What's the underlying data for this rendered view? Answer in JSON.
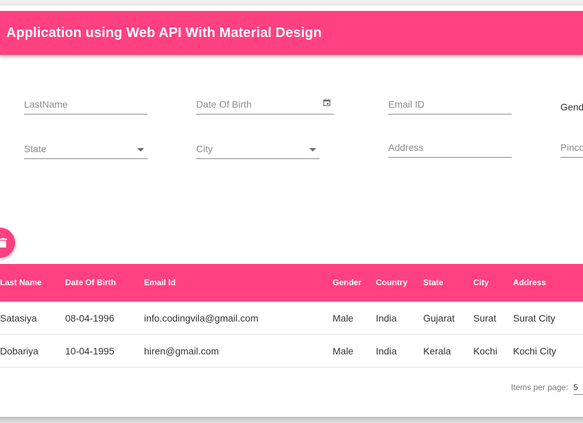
{
  "header": {
    "title": "Application using Web API With Material Design"
  },
  "form": {
    "row1": {
      "lastname_placeholder": "LastName",
      "dob_placeholder": "Date Of Birth",
      "email_placeholder": "Email ID",
      "gender_label": "Gend"
    },
    "row2": {
      "state_placeholder": "State",
      "city_placeholder": "City",
      "address_placeholder": "Address",
      "pincode_placeholder": "Pinco"
    }
  },
  "fab": {
    "icon": "delete-icon"
  },
  "table": {
    "columns": [
      "Last Name",
      "Date Of Birth",
      "Email Id",
      "Gender",
      "Country",
      "State",
      "City",
      "Address"
    ],
    "rows": [
      [
        "Satasiya",
        "08-04-1996",
        "info.codingvila@gmail.com",
        "Male",
        "India",
        "Gujarat",
        "Surat",
        "Surat City"
      ],
      [
        "Dobariya",
        "10-04-1995",
        "hiren@gmail.com",
        "Male",
        "India",
        "Kerala",
        "Kochi",
        "Kochi City"
      ]
    ]
  },
  "paginator": {
    "label": "Items per page:",
    "page_size": "5"
  },
  "colors": {
    "accent": "#ff4081"
  }
}
